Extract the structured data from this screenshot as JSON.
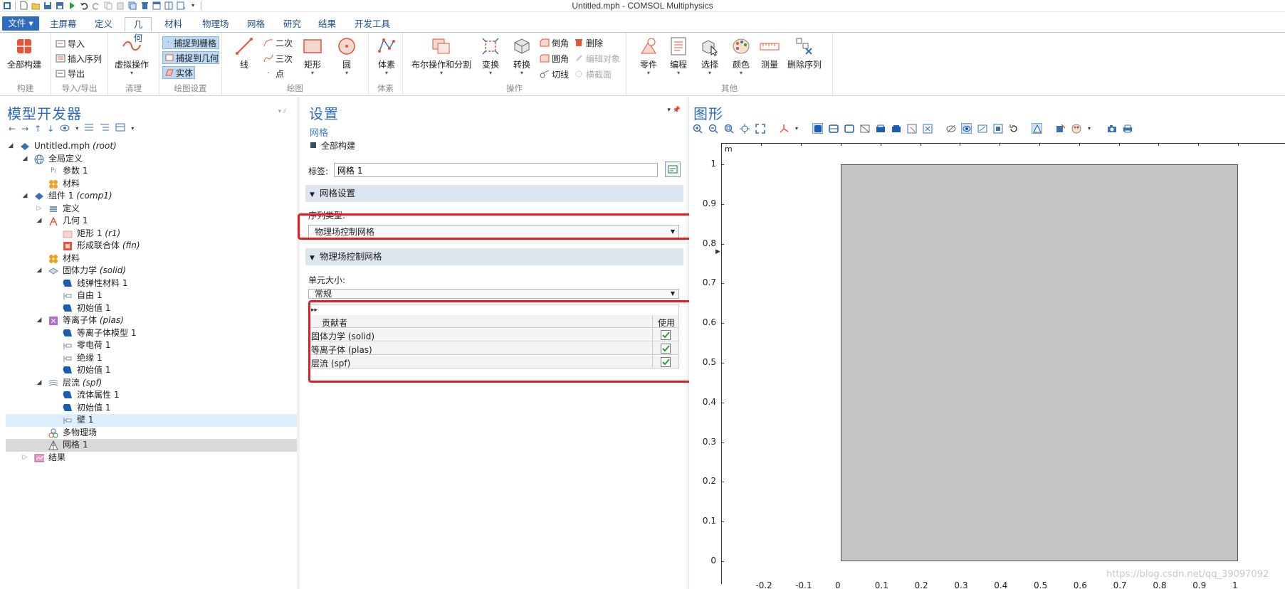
{
  "window": {
    "title": "Untitled.mph - COMSOL Multiphysics"
  },
  "tabs": [
    "文件 ▾",
    "主屏幕",
    "定义",
    "几何",
    "材料",
    "物理场",
    "网格",
    "研究",
    "结果",
    "开发工具"
  ],
  "ribbon": {
    "build_all": "全部构建",
    "build_group": "构建",
    "import": "导入",
    "insert_sequence": "插入序列",
    "export": "导出",
    "import_export_group": "导入/导出",
    "virtual_ops": "虚拟操作",
    "cleanup_group": "清理",
    "snap_grid": "捕捉到栅格",
    "snap_geometry": "捕捉到几何",
    "solid": "实体",
    "draw_settings_group": "绘图设置",
    "line": "线",
    "quadratic": "二次",
    "cubic": "三次",
    "point": "点",
    "rectangle": "矩形",
    "circle": "圆",
    "draw_group": "绘图",
    "block": "体素",
    "block_group": "体素",
    "boolean": "布尔操作和分割",
    "transform": "变换",
    "convert": "转换",
    "chamfer": "倒角",
    "fillet": "圆角",
    "tangent": "切线",
    "delete": "删除",
    "edit_object": "编辑对象",
    "cross_section": "横截面",
    "ops_group": "操作",
    "parts": "零件",
    "programming": "编程",
    "selection": "选择",
    "color": "颜色",
    "measure": "测量",
    "delete_sequence": "删除序列",
    "other_group": "其他"
  },
  "model_builder": {
    "title": "模型开发器",
    "tree": [
      {
        "label": "Untitled.mph",
        "tag": "(root)"
      },
      {
        "label": "全局定义",
        "tag": ""
      },
      {
        "label": "参数 1",
        "tag": ""
      },
      {
        "label": "材料",
        "tag": ""
      },
      {
        "label": "组件 1",
        "tag": "(comp1)"
      },
      {
        "label": "定义",
        "tag": ""
      },
      {
        "label": "几何 1",
        "tag": ""
      },
      {
        "label": "矩形 1",
        "tag": "(r1)"
      },
      {
        "label": "形成联合体",
        "tag": "(fin)"
      },
      {
        "label": "材料",
        "tag": ""
      },
      {
        "label": "固体力学",
        "tag": "(solid)"
      },
      {
        "label": "线弹性材料 1",
        "tag": ""
      },
      {
        "label": "自由 1",
        "tag": ""
      },
      {
        "label": "初始值 1",
        "tag": ""
      },
      {
        "label": "等离子体",
        "tag": "(plas)"
      },
      {
        "label": "等离子体模型 1",
        "tag": ""
      },
      {
        "label": "零电荷 1",
        "tag": ""
      },
      {
        "label": "绝缘 1",
        "tag": ""
      },
      {
        "label": "初始值 1",
        "tag": ""
      },
      {
        "label": "层流",
        "tag": "(spf)"
      },
      {
        "label": "流体属性 1",
        "tag": ""
      },
      {
        "label": "初始值 1",
        "tag": ""
      },
      {
        "label": "壁 1",
        "tag": ""
      },
      {
        "label": "多物理场",
        "tag": ""
      },
      {
        "label": "网格 1",
        "tag": ""
      },
      {
        "label": "结果",
        "tag": ""
      }
    ]
  },
  "settings": {
    "title": "设置",
    "subtitle": "网格",
    "build_all": "全部构建",
    "label_caption": "标签:",
    "label_value": "网格 1",
    "mesh_settings_section": "网格设置",
    "sequence_type_label": "序列类型:",
    "sequence_type_value": "物理场控制网格",
    "physics_mesh_section": "物理场控制网格",
    "element_size_label": "单元大小:",
    "element_size_value": "常规",
    "table_header_contributor": "贡献者",
    "table_header_use": "使用",
    "contributors": [
      {
        "name": "固体力学 (solid)",
        "use": true
      },
      {
        "name": "等离子体 (plas)",
        "use": true
      },
      {
        "name": "层流 (spf)",
        "use": true
      }
    ]
  },
  "graphics": {
    "title": "图形",
    "unit": "m",
    "y_ticks": [
      "1",
      "0.9",
      "0.8",
      "0.7",
      "0.6",
      "0.5",
      "0.4",
      "0.3",
      "0.2",
      "0.1",
      "0"
    ],
    "x_ticks": [
      "-0.2",
      "-0.1",
      "0",
      "0.1",
      "0.2",
      "0.3",
      "0.4",
      "0.5",
      "0.6",
      "0.7",
      "0.8",
      "0.9",
      "1"
    ],
    "watermark": "https://blog.csdn.net/qq_39097092"
  }
}
